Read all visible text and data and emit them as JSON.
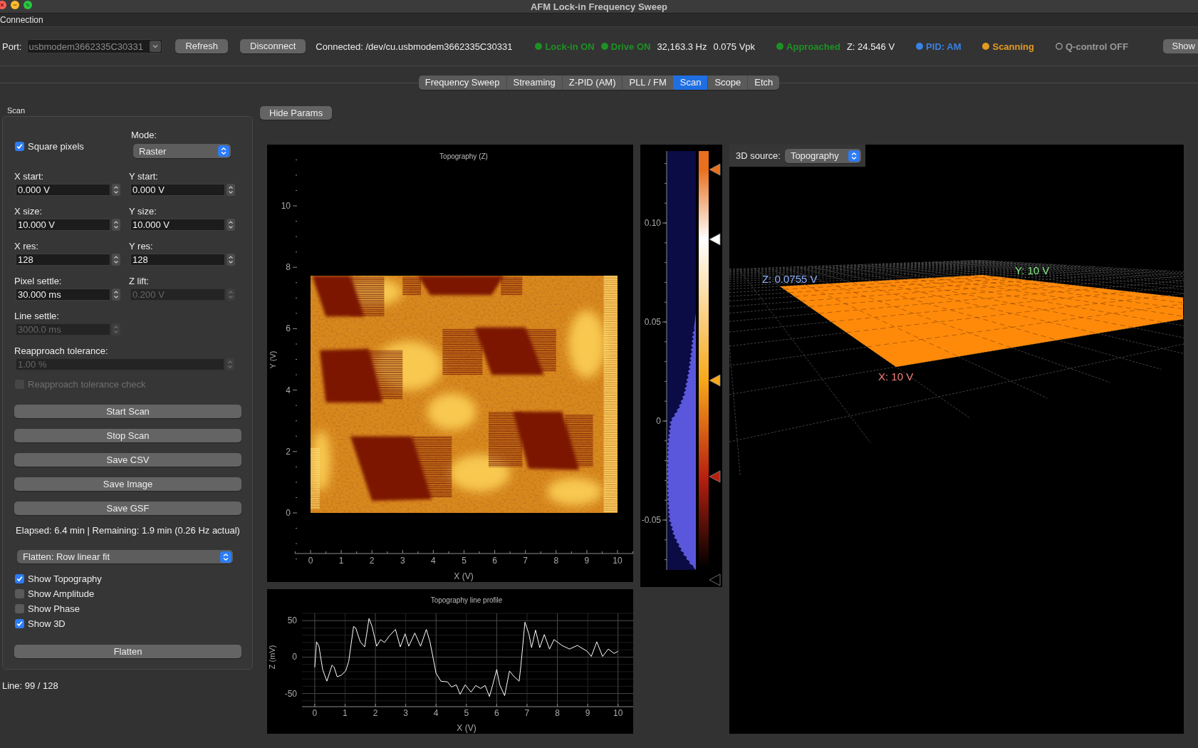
{
  "window": {
    "title": "AFM Lock-in Frequency Sweep"
  },
  "connection": {
    "title": "Connection",
    "port_label": "Port:",
    "port_value": "usbmodem3662335C30331",
    "buttons": [
      "Refresh",
      "Disconnect"
    ],
    "status_text": "Connected: /dev/cu.usbmodem3662335C30331",
    "status_groups": [
      {
        "items": [
          {
            "kind": "indicator",
            "label": "Lock-in ON",
            "color": "#1e9124",
            "on": true
          },
          {
            "kind": "indicator",
            "label": "Drive ON",
            "color": "#1e9124",
            "on": true
          },
          {
            "kind": "reading",
            "label": "32,163.3 Hz"
          },
          {
            "kind": "reading",
            "label": "0.075 Vpk"
          }
        ]
      },
      {
        "items": [
          {
            "kind": "indicator",
            "label": "Approached",
            "color": "#1e9124",
            "on": true
          },
          {
            "kind": "reading",
            "label": "Z: 24.546 V"
          }
        ]
      },
      {
        "items": [
          {
            "kind": "indicator",
            "label": "PID: AM",
            "color": "#3a82e4",
            "on": true
          }
        ]
      },
      {
        "items": [
          {
            "kind": "indicator",
            "label": "Scanning",
            "color": "#e39a22",
            "on": true
          }
        ]
      },
      {
        "items": [
          {
            "kind": "indicator",
            "label": "Q-control OFF",
            "color": "#9a9a9a",
            "on": false
          }
        ]
      }
    ],
    "show_button": "Show"
  },
  "tabs": [
    {
      "label": "Frequency Sweep",
      "selected": false
    },
    {
      "label": "Streaming",
      "selected": false
    },
    {
      "label": "Z-PID (AM)",
      "selected": false
    },
    {
      "label": "PLL / FM",
      "selected": false
    },
    {
      "label": "Scan",
      "selected": true
    },
    {
      "label": "Scope",
      "selected": false
    },
    {
      "label": "Etch",
      "selected": false
    }
  ],
  "scan_panel": {
    "title": "Scan",
    "square_pixels": {
      "label": "Square pixels",
      "checked": true
    },
    "mode": {
      "label": "Mode:",
      "value": "Raster"
    },
    "fields": [
      {
        "kind": "half",
        "label": "X start:",
        "value": "0.000 V",
        "disabled": false
      },
      {
        "kind": "half",
        "label": "Y start:",
        "value": "0.000 V",
        "disabled": false
      },
      {
        "kind": "half",
        "label": "X size:",
        "value": "10.000 V",
        "disabled": false
      },
      {
        "kind": "half",
        "label": "Y size:",
        "value": "10.000 V",
        "disabled": false
      },
      {
        "kind": "half",
        "label": "X res:",
        "value": "128",
        "disabled": false
      },
      {
        "kind": "half",
        "label": "Y res:",
        "value": "128",
        "disabled": false
      },
      {
        "kind": "half",
        "label": "Pixel settle:",
        "value": "30.000 ms",
        "disabled": false
      },
      {
        "kind": "half",
        "label": "Z lift:",
        "value": "0.200 V",
        "disabled": true
      },
      {
        "kind": "half",
        "label": "Line settle:",
        "value": "3000.0 ms",
        "disabled": true
      },
      {
        "kind": "wide",
        "label": "Reapproach tolerance:",
        "value": "1.00 %",
        "disabled": true
      }
    ],
    "tolerance_check": {
      "label": "Reapproach tolerance check",
      "checked": false,
      "disabled": true
    },
    "actions": [
      "Start Scan",
      "Stop Scan",
      "Save CSV",
      "Save Image",
      "Save GSF"
    ],
    "progress_text": "Elapsed: 6.4 min | Remaining: 1.9 min (0.26 Hz actual)",
    "flatten_mode": "Flatten: Row linear fit",
    "show_options": [
      {
        "label": "Show Topography",
        "checked": true
      },
      {
        "label": "Show Amplitude",
        "checked": false
      },
      {
        "label": "Show Phase",
        "checked": false
      },
      {
        "label": "Show 3D",
        "checked": true
      }
    ],
    "flatten_button": "Flatten"
  },
  "line_status": "Line: 99 / 128",
  "hide_params_button": "Hide Params",
  "topography_plot": {
    "title": "Topography (Z)",
    "xlabel": "X (V)",
    "ylabel": "Y (V)",
    "xticks": [
      "0",
      "1",
      "2",
      "3",
      "4",
      "5",
      "6",
      "7",
      "8",
      "9",
      "10"
    ],
    "yticks": [
      "10",
      "8",
      "6",
      "4",
      "2",
      "0"
    ]
  },
  "colorbar": {
    "ticks": [
      "0.10",
      "0.05",
      "0",
      "-0.05"
    ],
    "handles": [
      {
        "color": "#e8701e"
      },
      {
        "color": "#ffffff"
      },
      {
        "color": "#f7a81b"
      },
      {
        "color": "#b82010"
      },
      {
        "color": "#000000"
      }
    ]
  },
  "view_3d": {
    "source_label": "3D source:",
    "source_value": "Topography",
    "axis_labels": [
      {
        "text": "Z: 0.0755 V",
        "color": "#8fb0ff"
      },
      {
        "text": "Y: 10 V",
        "color": "#86ec86"
      },
      {
        "text": "X: 10 V",
        "color": "#f28080"
      }
    ]
  },
  "line_profile": {
    "chart_data": {
      "type": "line",
      "title": "Topography line profile",
      "xlabel": "X (V)",
      "ylabel": "Z (mV)",
      "grid": true,
      "x": [
        0,
        0.06,
        0.14,
        0.26,
        0.4,
        0.57,
        0.64,
        0.74,
        0.87,
        1.02,
        1.12,
        1.28,
        1.35,
        1.5,
        1.65,
        1.79,
        1.89,
        2.04,
        2.17,
        2.3,
        2.46,
        2.66,
        2.82,
        2.98,
        3.1,
        3.3,
        3.49,
        3.68,
        3.8,
        4.0,
        4.16,
        4.38,
        4.51,
        4.67,
        4.79,
        4.96,
        5.15,
        5.31,
        5.47,
        5.62,
        5.76,
        5.87,
        6.0,
        6.1,
        6.26,
        6.42,
        6.58,
        6.74,
        6.8,
        6.93,
        7.06,
        7.15,
        7.28,
        7.42,
        7.57,
        7.74,
        7.89,
        8.15,
        8.4,
        8.66,
        8.98,
        9.12,
        9.3,
        9.49,
        9.68,
        9.87,
        10
      ],
      "series": [
        {
          "color": "#ffffff",
          "values": [
            -14,
            21,
            15,
            -17,
            -33,
            -11,
            -14,
            -27,
            -25,
            -19,
            -6,
            42,
            40,
            21,
            14,
            53,
            42,
            15,
            24,
            20,
            29,
            38,
            14,
            32,
            15,
            33,
            15,
            38,
            21,
            -22,
            -33,
            -34,
            -41,
            -38,
            -51,
            -38,
            -48,
            -39,
            -43,
            -39,
            -54,
            -38,
            -17,
            -38,
            -53,
            -19,
            -27,
            -33,
            -11,
            48,
            32,
            13,
            37,
            13,
            31,
            11,
            24,
            16,
            11,
            16,
            8,
            1,
            21,
            1,
            11,
            5,
            8
          ]
        }
      ],
      "xlim": [
        -0.42,
        10.5
      ],
      "ylim": [
        -68,
        60
      ],
      "xticks": [
        0,
        1,
        2,
        3,
        4,
        5,
        6,
        7,
        8,
        9,
        10
      ],
      "yticks": [
        -50,
        0,
        50
      ]
    }
  }
}
